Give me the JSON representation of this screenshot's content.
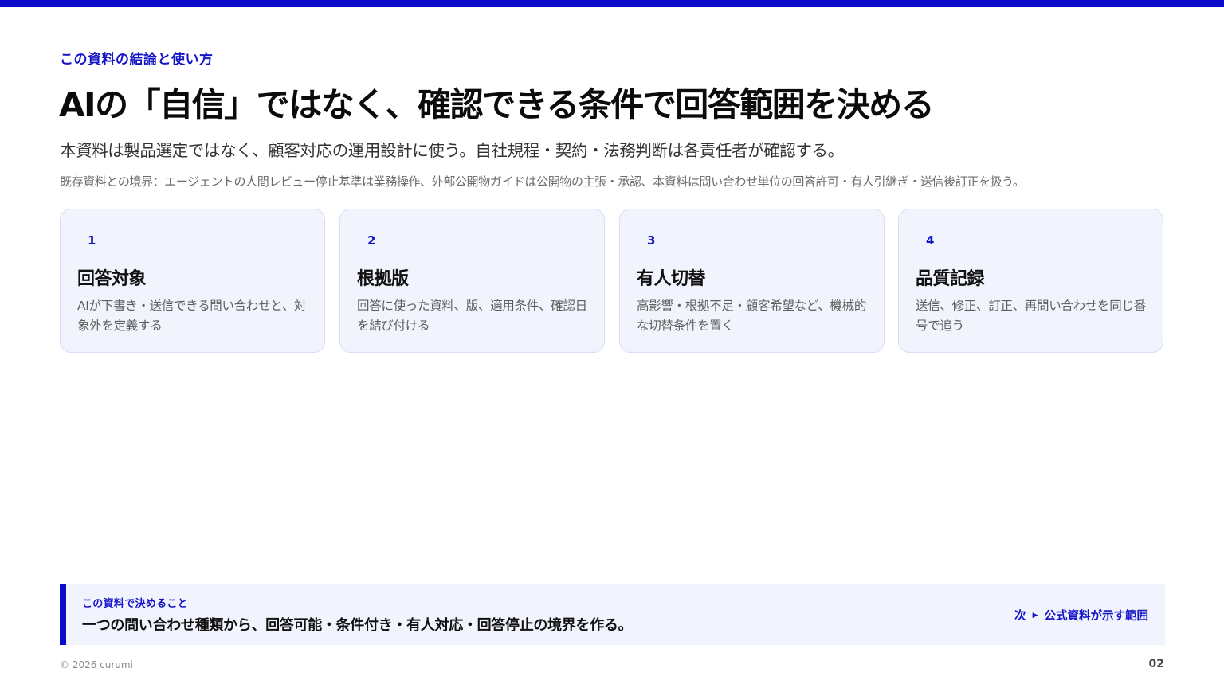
{
  "colors": {
    "accent": "#0a0ccc",
    "card_bg": "#f2f4fd",
    "card_border": "#d8dcf4"
  },
  "header": {
    "eyebrow": "この資料の結論と使い方",
    "title": "AIの「自信」ではなく、確認できる条件で回答範囲を決める",
    "subtitle": "本資料は製品選定ではなく、顧客対応の運用設計に使う。自社規程・契約・法務判断は各責任者が確認する。",
    "boundary_note": "既存資料との境界：エージェントの人間レビュー停止基準は業務操作、外部公開物ガイドは公開物の主張・承認、本資料は問い合わせ単位の回答許可・有人引継ぎ・送信後訂正を扱う。"
  },
  "cards": [
    {
      "number": "1",
      "title": "回答対象",
      "description": "AIが下書き・送信できる問い合わせと、対象外を定義する"
    },
    {
      "number": "2",
      "title": "根拠版",
      "description": "回答に使った資料、版、適用条件、確認日を結び付ける"
    },
    {
      "number": "3",
      "title": "有人切替",
      "description": "高影響・根拠不足・顧客希望など、機械的な切替条件を置く"
    },
    {
      "number": "4",
      "title": "品質記録",
      "description": "送信、修正、訂正、再問い合わせを同じ番号で追う"
    }
  ],
  "callout": {
    "label": "この資料で決めること",
    "text": "一つの問い合わせ種類から、回答可能・条件付き・有人対応・回答停止の境界を作る。",
    "next_prefix": "次",
    "next_icon": "triangle-right-icon",
    "next_label": "公式資料が示す範囲"
  },
  "footer": {
    "copyright": "© 2026 curumi",
    "page_number": "02"
  }
}
